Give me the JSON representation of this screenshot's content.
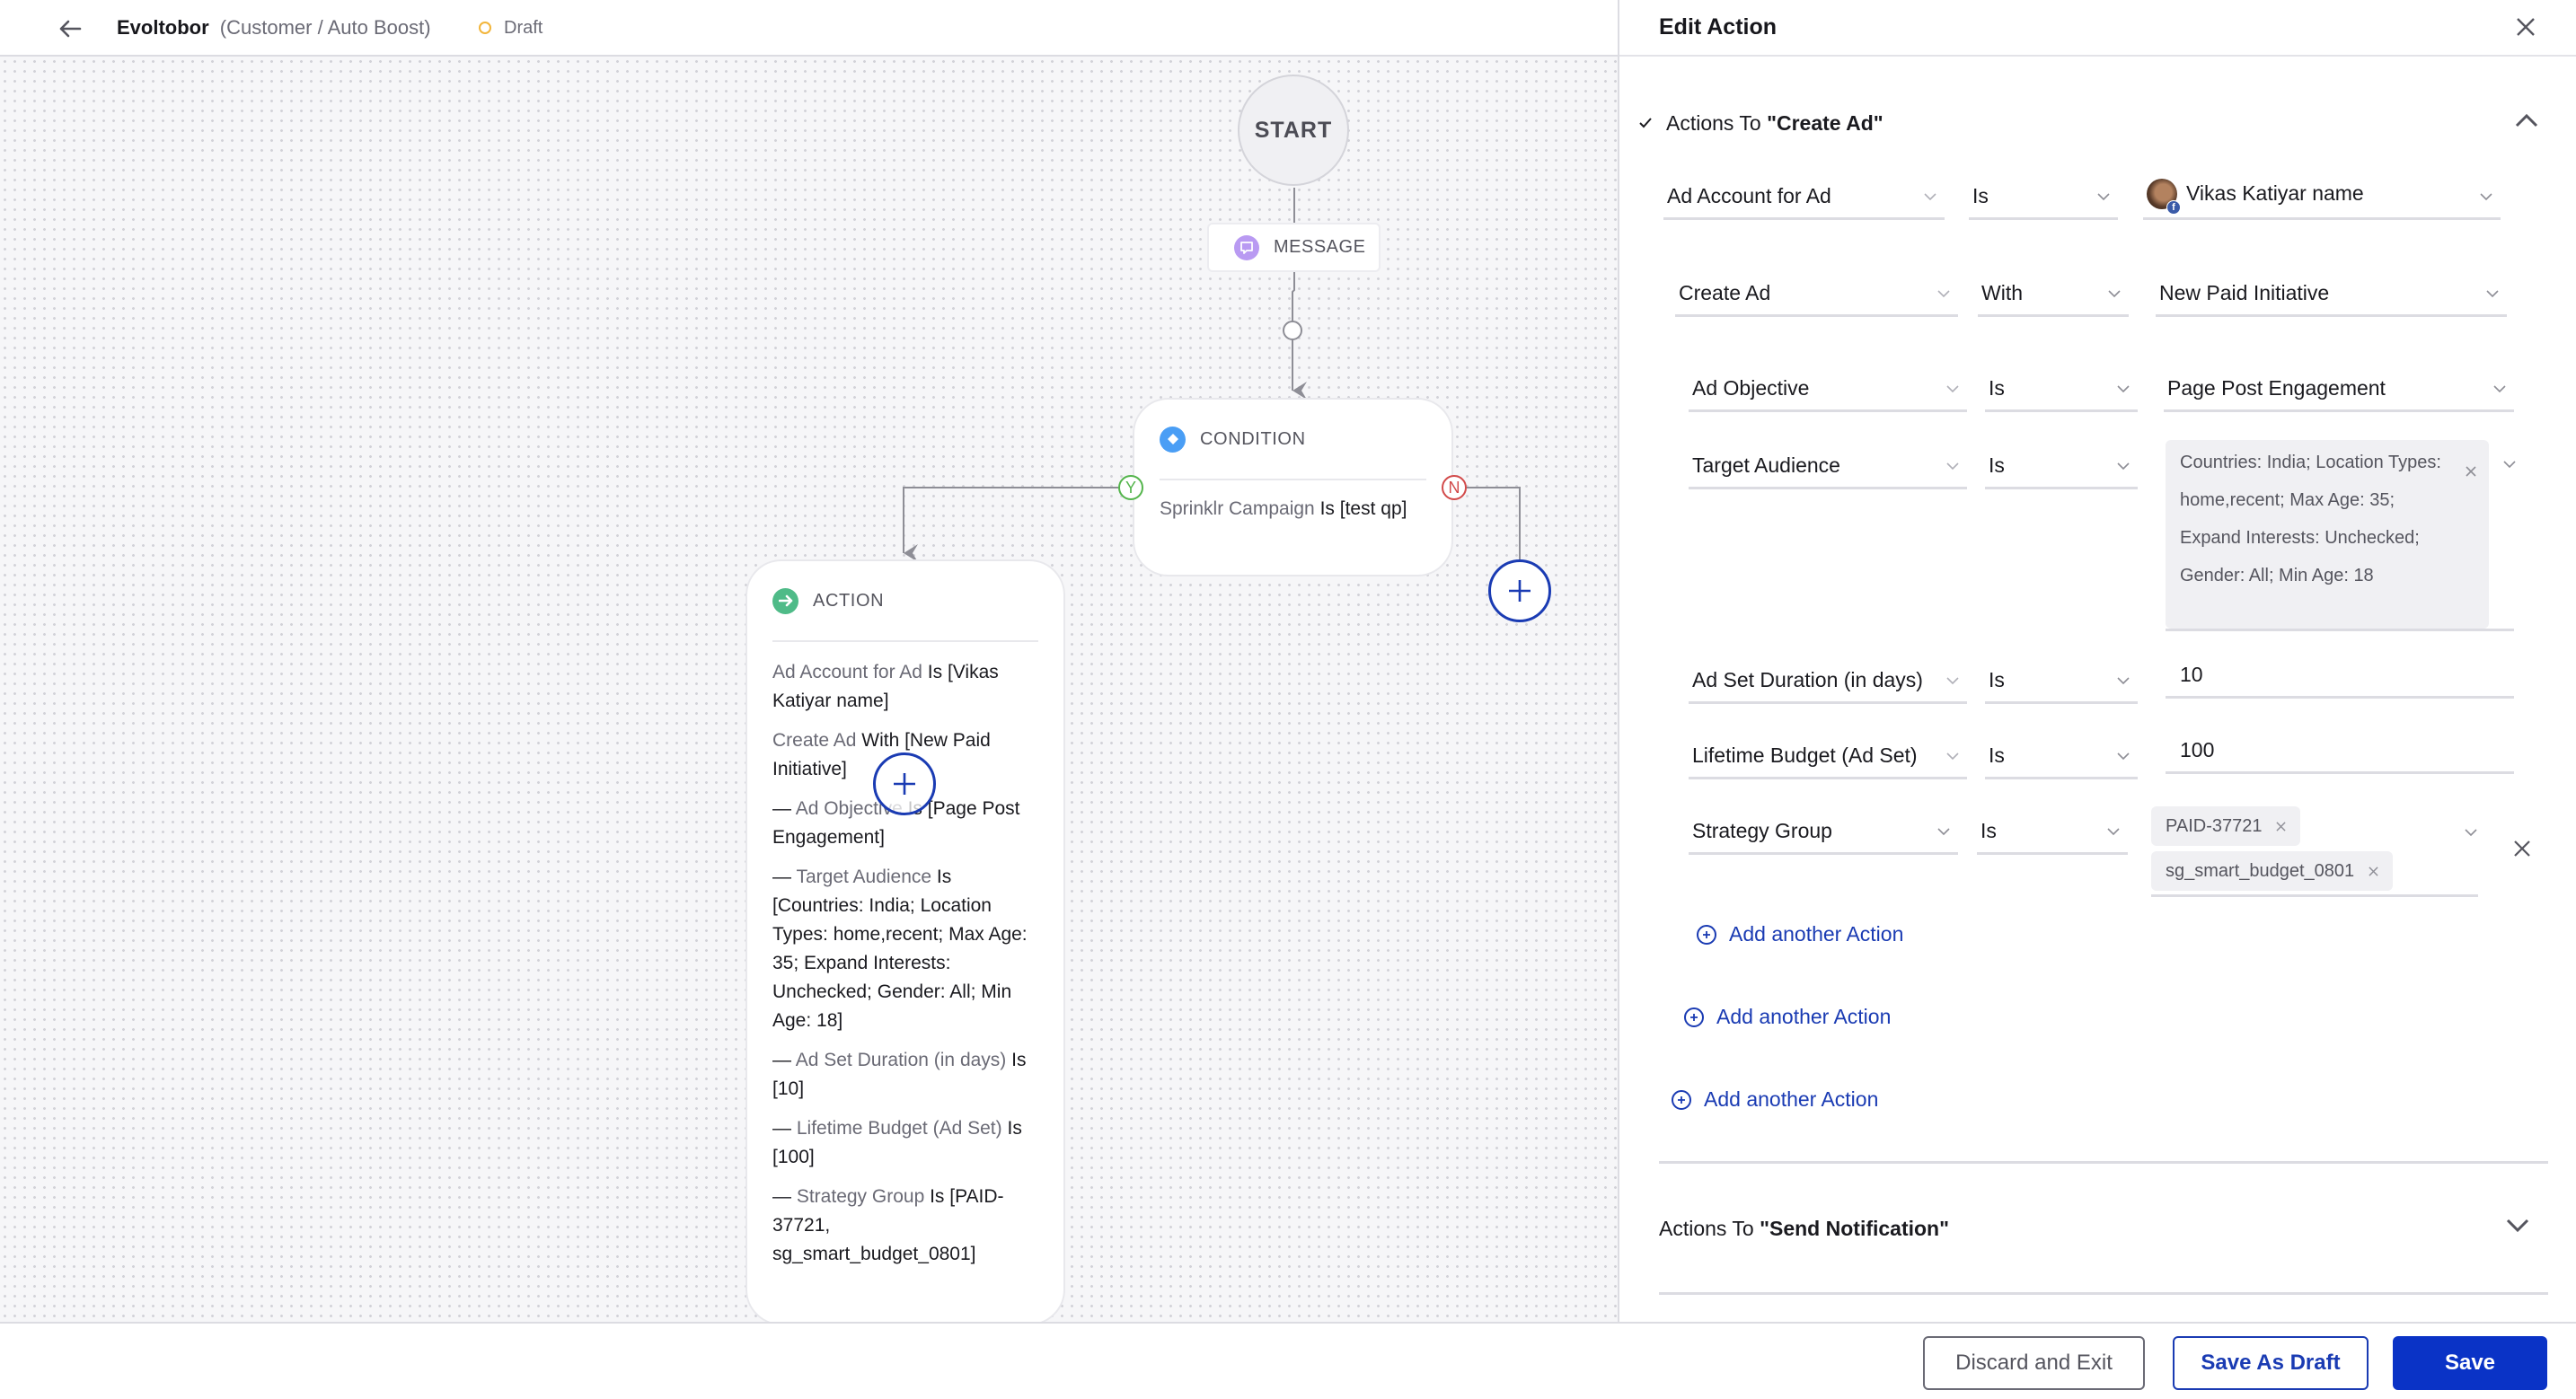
{
  "header": {
    "title": "Evoltobor",
    "subtitle": "(Customer / Auto Boost)",
    "status": "Draft",
    "status_color": "#f2b53a"
  },
  "canvas": {
    "start_label": "START",
    "message_label": "MESSAGE",
    "condition": {
      "label": "CONDITION",
      "field": "Sprinklr Campaign",
      "rest": "Is [test qp]",
      "yes_label": "Y",
      "no_label": "N"
    },
    "action": {
      "label": "ACTION",
      "lines": [
        {
          "prefix": "",
          "field": "Ad Account for Ad",
          "rest": "Is [Vikas Katiyar name]"
        },
        {
          "prefix": "",
          "field": "Create Ad",
          "rest": "With [New Paid Initiative]"
        },
        {
          "prefix": "— ",
          "field": "Ad Objective",
          "rest": "Is [Page Post Engagement]"
        },
        {
          "prefix": "— ",
          "field": "Target Audience",
          "rest": "Is [Countries: India; Location Types: home,recent; Max Age: 35; Expand Interests: Unchecked; Gender: All; Min Age: 18]"
        },
        {
          "prefix": "— ",
          "field": "Ad Set Duration (in days)",
          "rest": "Is [10]"
        },
        {
          "prefix": "— ",
          "field": "Lifetime Budget (Ad Set)",
          "rest": "Is [100]"
        },
        {
          "prefix": "— ",
          "field": "Strategy Group",
          "rest": "Is [PAID-37721, sg_smart_budget_0801]"
        }
      ]
    }
  },
  "panel": {
    "title": "Edit Action",
    "section1": {
      "prefix": "Actions To ",
      "name": "\"Create Ad\""
    },
    "rows": {
      "ad_account": {
        "field": "Ad Account for Ad",
        "op": "Is",
        "value": "Vikas Katiyar name"
      },
      "create_ad": {
        "field": "Create Ad",
        "op": "With",
        "value": "New Paid Initiative"
      },
      "ad_objective": {
        "field": "Ad Objective",
        "op": "Is",
        "value": "Page Post Engagement"
      },
      "target_audience": {
        "field": "Target Audience",
        "op": "Is",
        "value": "Countries: India; Location Types: home,recent; Max Age: 35; Expand Interests: Unchecked; Gender: All; Min Age: 18"
      },
      "duration": {
        "field": "Ad Set Duration (in days)",
        "op": "Is",
        "value": "10"
      },
      "budget": {
        "field": "Lifetime Budget (Ad Set)",
        "op": "Is",
        "value": "100"
      },
      "strategy": {
        "field": "Strategy Group",
        "op": "Is",
        "chips": [
          "PAID-37721",
          "sg_smart_budget_0801"
        ]
      }
    },
    "add_action_label": "Add another Action",
    "section2": {
      "prefix": "Actions To ",
      "name": "\"Send Notification\""
    }
  },
  "footer": {
    "discard": "Discard and Exit",
    "draft": "Save As Draft",
    "save": "Save"
  },
  "colors": {
    "primary": "#0a33c6",
    "yes": "#54b54c",
    "no": "#d24a4a",
    "message_icon": "#b99af2",
    "condition_icon": "#4a9ef5",
    "action_icon": "#4fbb88"
  }
}
